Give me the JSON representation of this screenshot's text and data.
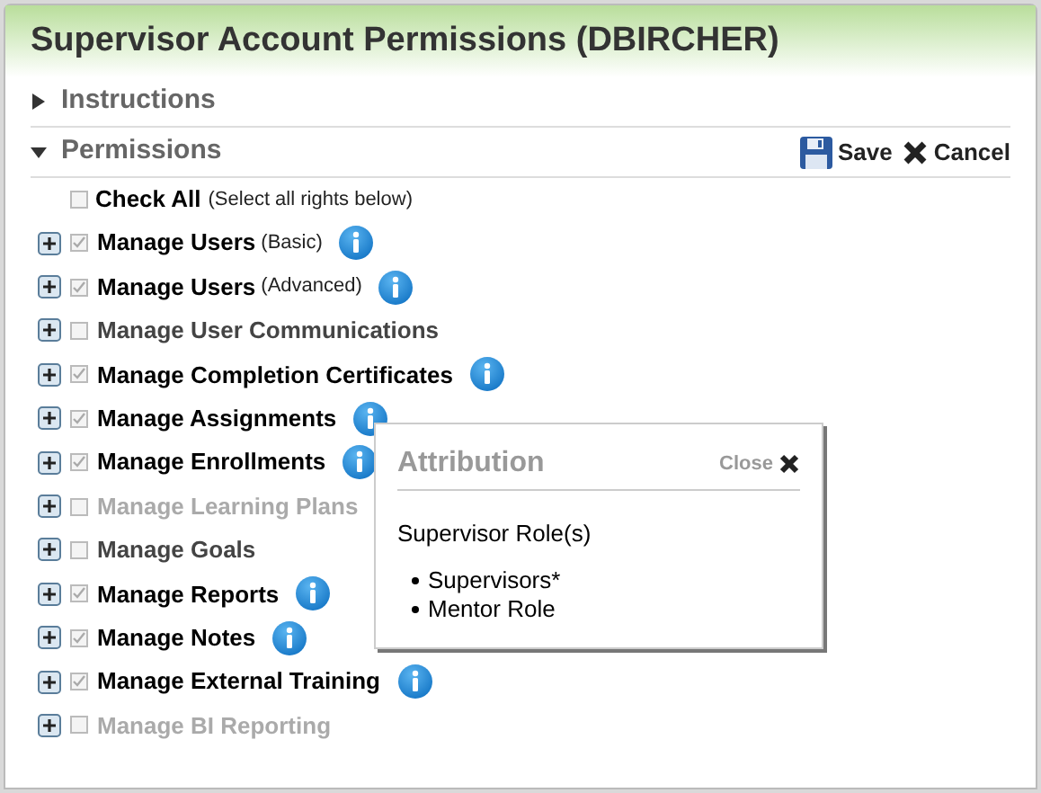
{
  "window": {
    "title": "Supervisor Account Permissions (DBIRCHER)"
  },
  "sections": [
    {
      "label": "Instructions",
      "expanded": false
    },
    {
      "label": "Permissions",
      "expanded": true
    }
  ],
  "actions": [
    {
      "kind": "save",
      "label": "Save"
    },
    {
      "kind": "cancel",
      "label": "Cancel"
    }
  ],
  "check_all": {
    "label": "Check All",
    "note": "(Select all rights below)",
    "checked": false
  },
  "permissions": [
    {
      "label": "Manage Users",
      "note": "(Basic)",
      "checked": true,
      "disabled": false,
      "info": true
    },
    {
      "label": "Manage Users",
      "note": "(Advanced)",
      "checked": true,
      "disabled": false,
      "info": true
    },
    {
      "label": "Manage User Communications",
      "checked": false,
      "disabled": false,
      "info": false
    },
    {
      "label": "Manage Completion Certificates",
      "checked": true,
      "disabled": false,
      "info": true
    },
    {
      "label": "Manage Assignments",
      "checked": true,
      "disabled": false,
      "info": true
    },
    {
      "label": "Manage Enrollments",
      "checked": true,
      "disabled": false,
      "info": true
    },
    {
      "label": "Manage Learning Plans",
      "checked": false,
      "disabled": true,
      "info": false
    },
    {
      "label": "Manage Goals",
      "checked": false,
      "disabled": false,
      "info": false
    },
    {
      "label": "Manage Reports",
      "checked": true,
      "disabled": false,
      "info": true
    },
    {
      "label": "Manage Notes",
      "checked": true,
      "disabled": false,
      "info": true
    },
    {
      "label": "Manage External Training",
      "checked": true,
      "disabled": false,
      "info": true
    },
    {
      "label": "Manage BI Reporting",
      "checked": false,
      "disabled": true,
      "info": false
    }
  ],
  "popup": {
    "title": "Attribution",
    "close": "Close",
    "heading": "Supervisor Role(s)",
    "items": [
      "Supervisors*",
      "Mentor Role"
    ]
  }
}
